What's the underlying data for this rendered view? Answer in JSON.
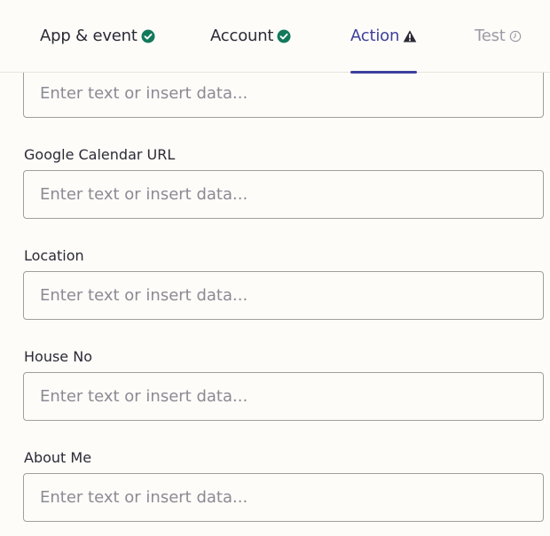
{
  "tabs": [
    {
      "label": "App & event",
      "status": "check-circle-icon",
      "status_color": "#13795b"
    },
    {
      "label": "Account",
      "status": "check-circle-icon",
      "status_color": "#13795b"
    },
    {
      "label": "Action",
      "status": "warning-triangle-icon",
      "status_color": "#2b2a35",
      "active": true
    },
    {
      "label": "Test",
      "status": "clock-icon",
      "status_color": "#9c9aa3"
    }
  ],
  "colors": {
    "accent": "#3d3f9c",
    "success": "#13795b",
    "muted": "#9c9aa3",
    "background": "#fdfcf9"
  },
  "fields": [
    {
      "label": "",
      "placeholder": "Enter text or insert data..."
    },
    {
      "label": "Google Calendar URL",
      "placeholder": "Enter text or insert data..."
    },
    {
      "label": "Location",
      "placeholder": "Enter text or insert data..."
    },
    {
      "label": "House No",
      "placeholder": "Enter text or insert data..."
    },
    {
      "label": "About Me",
      "placeholder": "Enter text or insert data..."
    }
  ]
}
